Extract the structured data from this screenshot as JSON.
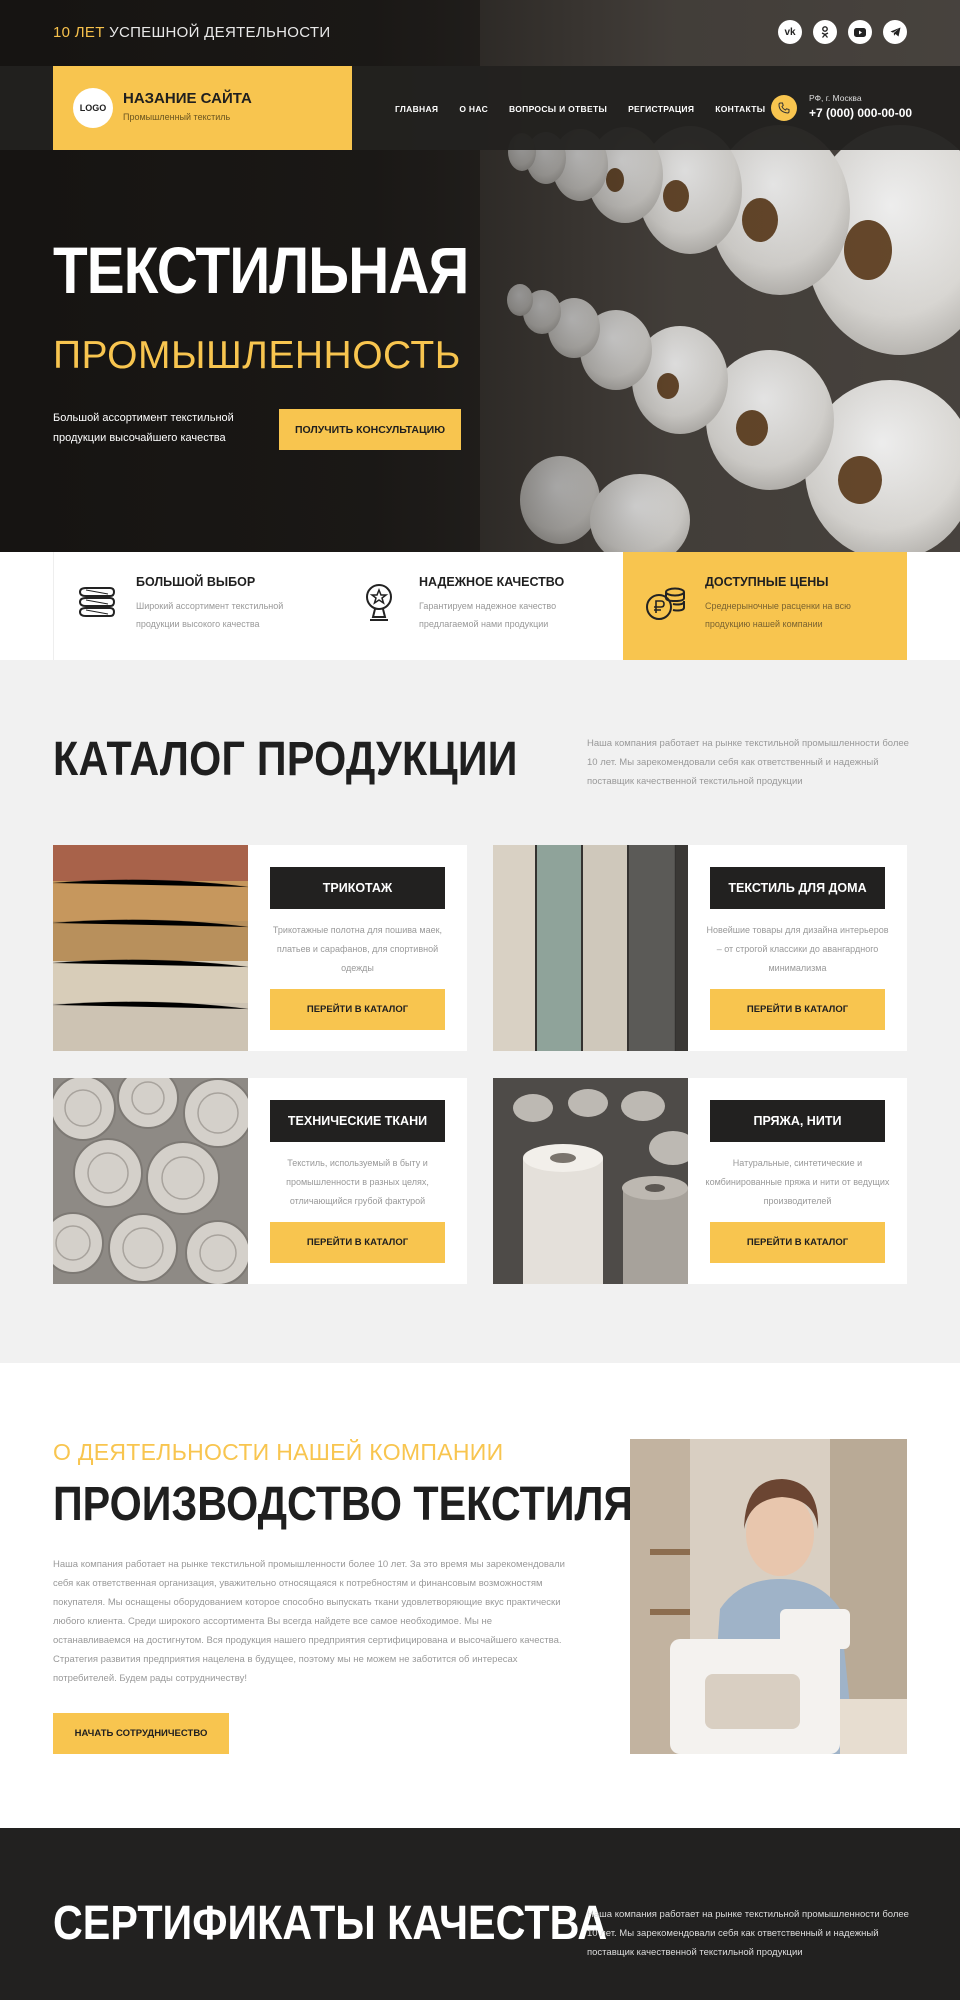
{
  "topbar": {
    "years_accent": "10 ЛЕТ",
    "years_rest": "УСПЕШНОЙ ДЕЯТЕЛЬНОСТИ",
    "socials": [
      "vk",
      "ok",
      "youtube",
      "telegram"
    ]
  },
  "brand": {
    "logo": "LOGO",
    "name": "НАЗАНИЕ САЙТА",
    "tagline": "Промышленный текстиль"
  },
  "nav": {
    "items": [
      "ГЛАВНАЯ",
      "О НАС",
      "ВОПРОСЫ И ОТВЕТЫ",
      "РЕГИСТРАЦИЯ",
      "КОНТАКТЫ"
    ],
    "menu_icon": "burger-icon"
  },
  "contact": {
    "city": "РФ, г. Москва",
    "phone": "+7 (000) 000-00-00"
  },
  "hero": {
    "title": "ТЕКСТИЛЬНАЯ",
    "subtitle": "ПРОМЫШЛЕННОСТЬ",
    "text": "Большой ассортимент текстильной продукции высочайшего качества",
    "button": "ПОЛУЧИТЬ КОНСУЛЬТАЦИЮ"
  },
  "features": [
    {
      "icon": "fabric-stack-icon",
      "title": "БОЛЬШОЙ ВЫБОР",
      "desc": "Широкий ассортимент текстильной продукции высокого качества"
    },
    {
      "icon": "award-icon",
      "title": "НАДЕЖНОЕ КАЧЕСТВО",
      "desc": "Гарантируем надежное качество предлагаемой нами продукции"
    },
    {
      "icon": "ruble-coins-icon",
      "title": "ДОСТУПНЫЕ ЦЕНЫ",
      "desc": "Среднерыночные расценки на всю продукцию нашей компании"
    }
  ],
  "catalog": {
    "title": "КАТАЛОГ ПРОДУКЦИИ",
    "desc": "Наша компания работает на рынке текстильной промышленности более 10 лет. Мы зарекомендовали себя как ответственный и надежный поставщик качественной текстильной продукции",
    "cards": [
      {
        "name": "ТРИКОТАЖ",
        "desc": "Трикотажные полотна для пошива маек, платьев и сарафанов, для спортивной одежды",
        "button": "ПЕРЕЙТИ В КАТАЛОГ"
      },
      {
        "name": "ТЕКСТИЛЬ ДЛЯ ДОМА",
        "desc": "Новейшие товары для дизайна интерьеров – от строгой классики до авангардного минимализма",
        "button": "ПЕРЕЙТИ В КАТАЛОГ"
      },
      {
        "name": "ТЕХНИЧЕСКИЕ ТКАНИ",
        "desc": "Текстиль, используемый в быту и промышленности в разных целях, отличающийся грубой фактурой",
        "button": "ПЕРЕЙТИ В КАТАЛОГ"
      },
      {
        "name": "ПРЯЖА, НИТИ",
        "desc": "Натуральные, синтетические и комбинированные пряжа и нити от ведущих производителей",
        "button": "ПЕРЕЙТИ В КАТАЛОГ"
      }
    ]
  },
  "about": {
    "kicker": "О ДЕЯТЕЛЬНОСТИ НАШЕЙ КОМПАНИИ",
    "title": "ПРОИЗВОДСТВО ТЕКСТИЛЯ",
    "text": "Наша компания работает на рынке текстильной промышленности более 10 лет. За это время мы зарекомендовали себя как ответственная организация, уважительно относящаяся к потребностям и финансовым возможностям покупателя. Мы оснащены оборудованием которое способно выпускать ткани удовлетворяющие вкус практически любого клиента. Среди широкого ассортимента Вы всегда найдете все самое необходимое. Мы не останавливаемся на достигнутом. Вся продукция нашего предприятия сертифицирована и высочайшего качества. Стратегия развития предприятия нацелена в будущее, поэтому мы не можем не заботится об интересах потребителей. Будем рады сотрудничеству!",
    "button": "НАЧАТЬ СОТРУДНИЧЕСТВО"
  },
  "certs": {
    "title": "СЕРТИФИКАТЫ КАЧЕСТВА",
    "desc": "Наша компания работает на рынке текстильной промышленности более 10 лет. Мы зарекомендовали себя как ответственный и надежный поставщик качественной текстильной продукции"
  },
  "colors": {
    "accent": "#f8c54f",
    "dark": "#222120",
    "light_bg": "#f1f1f1",
    "muted_text": "#999999"
  }
}
